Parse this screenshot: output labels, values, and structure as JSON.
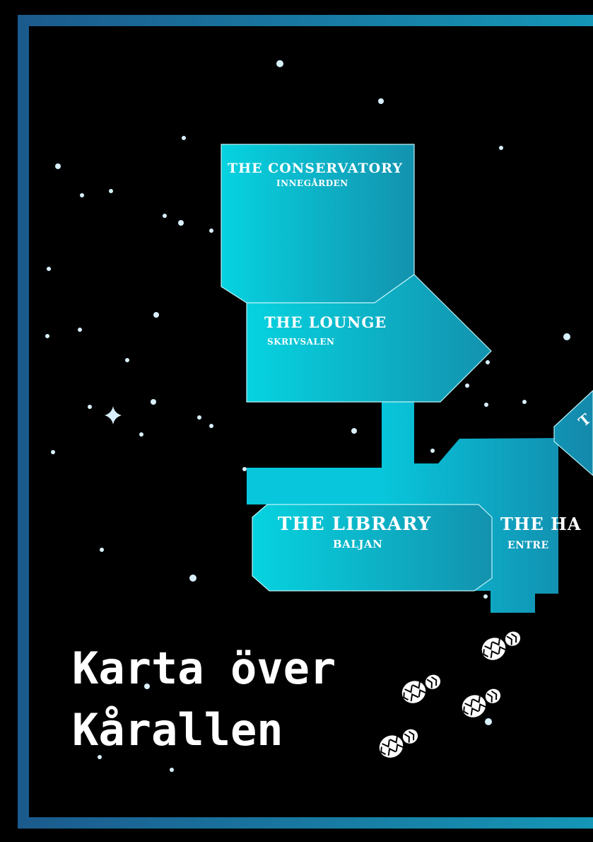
{
  "title": {
    "line1": "Karta över",
    "line2": "Kårallen"
  },
  "rooms": [
    {
      "id": "conservatory",
      "name": "THE CONSERVATORY",
      "sub": "INNEGÅRDEN"
    },
    {
      "id": "lounge",
      "name": "THE LOUNGE",
      "sub": "SKRIVSALEN"
    },
    {
      "id": "library",
      "name": "THE LIBRARY",
      "sub": "BALJAN"
    },
    {
      "id": "hall",
      "name": "THE HA",
      "sub": "ENTRE"
    },
    {
      "id": "partial-room",
      "name": "T",
      "sub": ""
    }
  ],
  "colors": {
    "background": "#000000",
    "frame_start": "#1b5a8c",
    "frame_end": "#1596b6",
    "room_start": "#06d3e0",
    "room_end": "#1392ae",
    "room_outline": "#bdf3f7",
    "star": "#d8f0fb",
    "footprint": "#ffffff"
  },
  "icons": {
    "footprints": "shoe-print-icon",
    "sparkle": "sparkle-star-icon"
  }
}
